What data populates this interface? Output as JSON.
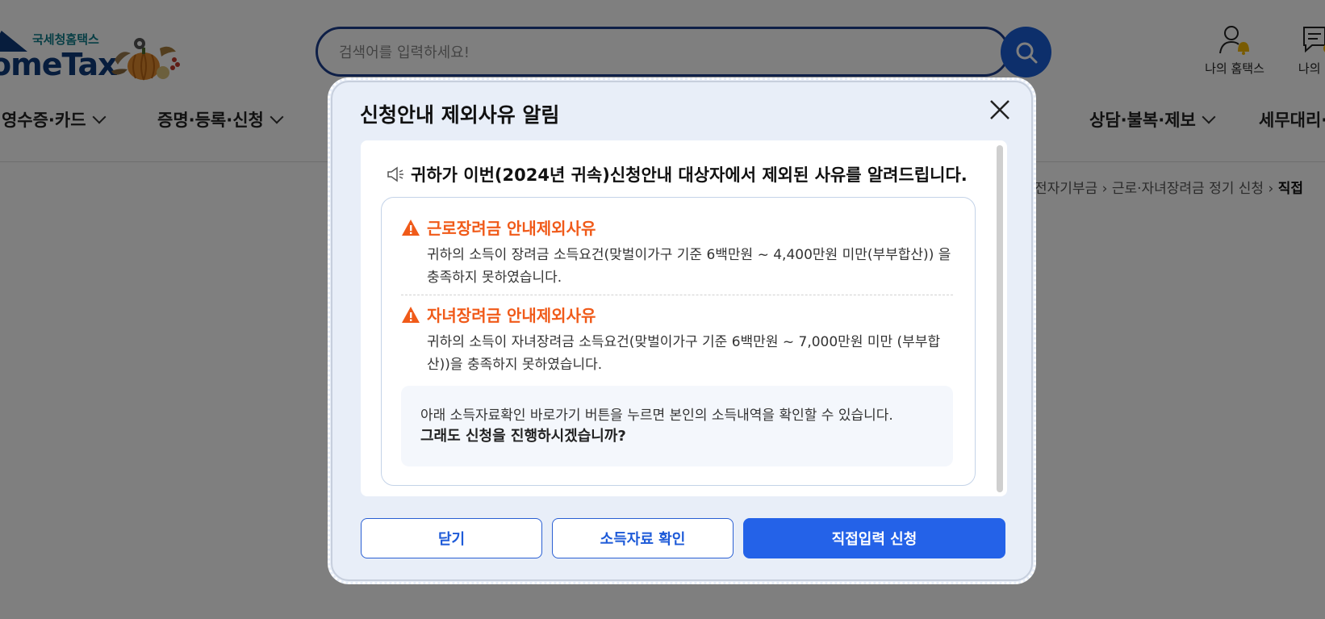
{
  "header": {
    "logo_sub": "국세청홈택스",
    "logo_main": "omeTax",
    "search_placeholder": "검색어를 입력하세요!",
    "util": [
      {
        "icon": "user-bell-icon",
        "label": "나의 홈택스"
      },
      {
        "icon": "message-icon",
        "label": "나의 메"
      }
    ],
    "gnb": [
      {
        "label": "·영수증·카드"
      },
      {
        "label": "증명·등록·신청"
      },
      {
        "label": "상담·불복·제보"
      },
      {
        "label": "세무대리·"
      }
    ]
  },
  "breadcrumb": {
    "items": [
      "전자기부금",
      "근로·자녀장려금 정기 신청"
    ],
    "current": "직접"
  },
  "modal": {
    "title": "신청안내 제외사유 알림",
    "notice": "귀하가 이번(2024년 귀속)신청안내 대상자에서 제외된 사유를 알려드립니다.",
    "reasons": [
      {
        "title": "근로장려금 안내제외사유",
        "text": "귀하의 소득이 장려금 소득요건(맞벌이가구 기준 6백만원 ~ 4,400만원 미만(부부합산)) 을 충족하지 못하였습니다."
      },
      {
        "title": "자녀장려금 안내제외사유",
        "text": "귀하의 소득이 자녀장려금 소득요건(맞벌이가구 기준 6백만원 ~ 7,000만원 미만 (부부합산))을 충족하지 못하였습니다."
      }
    ],
    "info_line1": "아래 소득자료확인 바로가기 버튼을 누르면 본인의 소득내역을 확인할 수 있습니다.",
    "info_line2": "그래도 신청을 진행하시겠습니까?",
    "buttons": {
      "close": "닫기",
      "income_check": "소득자료 확인",
      "direct_apply": "직접입력 신청"
    }
  },
  "colors": {
    "primary": "#2462e8",
    "warning": "#f05a19",
    "navy": "#0e3a7a",
    "modal_bg": "#e8eef8"
  }
}
